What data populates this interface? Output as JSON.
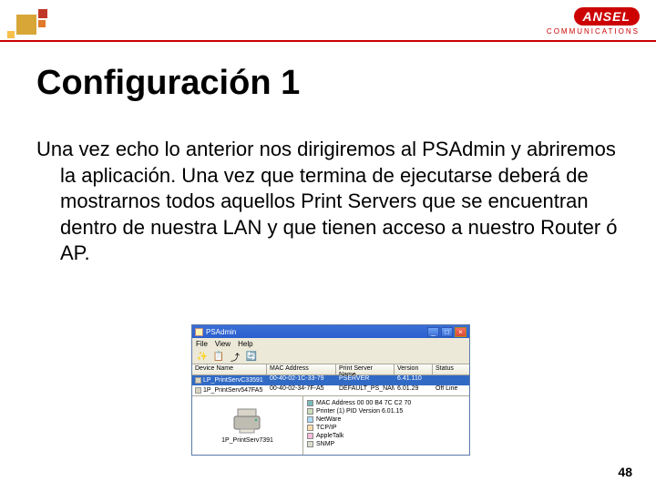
{
  "brand": {
    "name": "ANSEL",
    "subtitle": "COMMUNICATIONS"
  },
  "title": "Configuración 1",
  "body_text": "Una vez echo lo anterior nos dirigiremos al PSAdmin y abriremos la aplicación.  Una vez que termina de ejecutarse deberá de mostrarnos todos aquellos Print Servers que se encuentran dentro de nuestra LAN y que tienen acceso a nuestro Router ó AP.",
  "page_number": "48",
  "psadmin": {
    "window_title": "PSAdmin",
    "menus": {
      "file": "File",
      "view": "View",
      "help": "Help"
    },
    "columns": {
      "device": "Device Name",
      "mac": "MAC Address",
      "ps": "Print Server Name",
      "ver": "Version",
      "status": "Status"
    },
    "rows": [
      {
        "device": "LP_PrintServC33591",
        "mac": "00-40-02-1C-33-79",
        "ps": "PSERVER",
        "ver": "6.41.110",
        "status": ""
      },
      {
        "device": "1P_PrintServ547FA5",
        "mac": "00-40-02-34-7F-A5",
        "ps": "DEFAULT_PS_NAME",
        "ver": "6.01.29",
        "status": "Off Line"
      }
    ],
    "detail": {
      "left_label": "1P_PrintServ7391",
      "items": [
        {
          "label": "MAC Address 00 00 B4 7C C2 70",
          "icon": "mac"
        },
        {
          "label": "Printer (1)  PID Version 6.01.15",
          "icon": "prn"
        },
        {
          "label": "NetWare",
          "icon": "nw"
        },
        {
          "label": "TCP/IP",
          "icon": "tcp"
        },
        {
          "label": "AppleTalk",
          "icon": "at"
        },
        {
          "label": "SNMP",
          "icon": "snp"
        }
      ]
    }
  }
}
